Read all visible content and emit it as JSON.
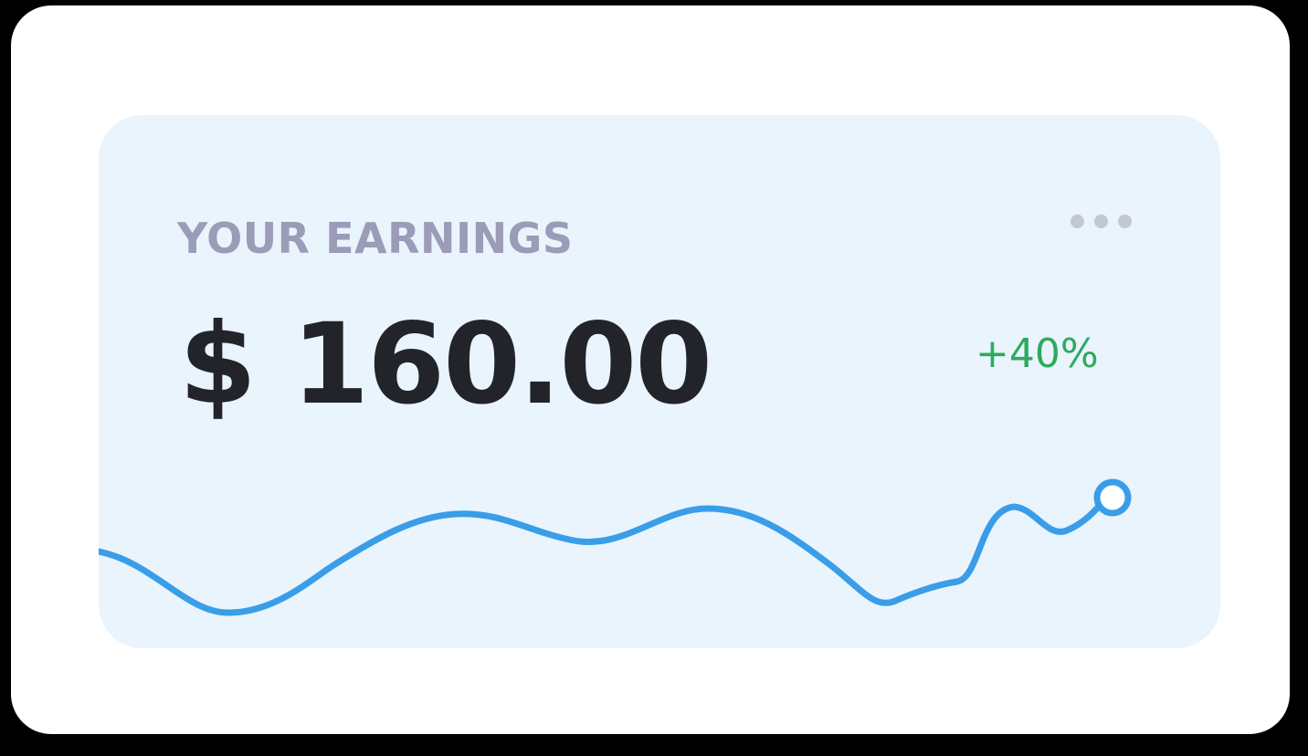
{
  "earnings": {
    "title": "YOUR EARNINGS",
    "amount": "$ 160.00",
    "change": "+40%",
    "menu_icon": "more-horizontal-icon"
  },
  "colors": {
    "line": "#3a9de8",
    "change": "#2eaa5e",
    "title": "#9b9cb8",
    "card": "#e9f4fd"
  }
}
